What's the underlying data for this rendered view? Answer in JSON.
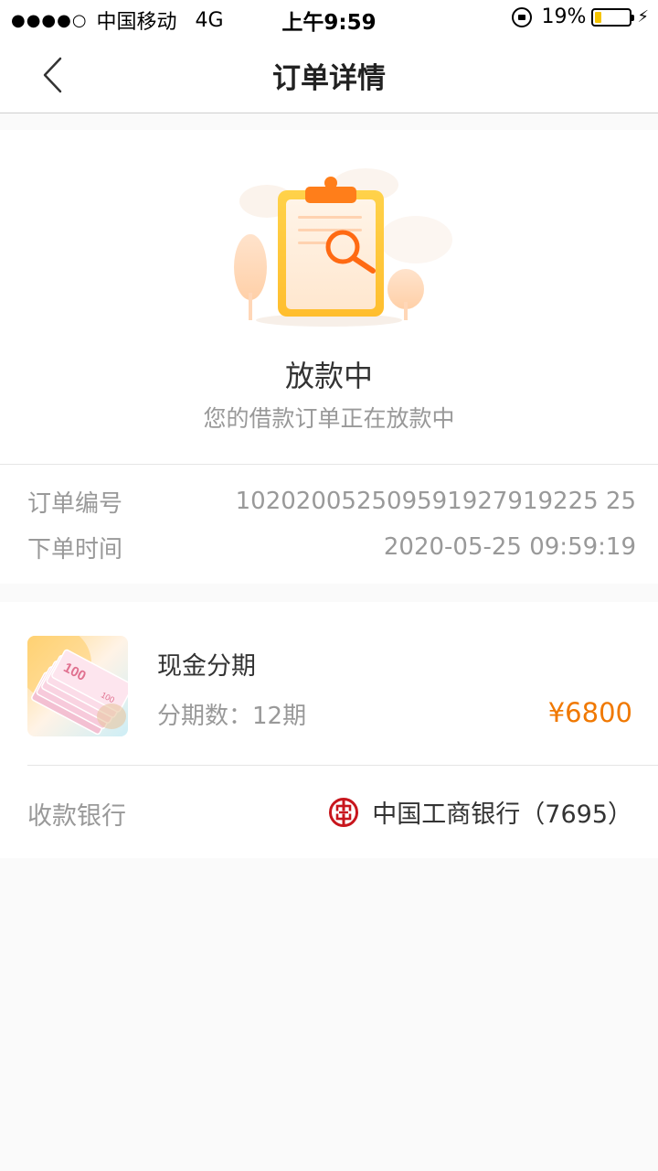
{
  "status_bar": {
    "signal": "●●●●○",
    "carrier": "中国移动",
    "network": "4G",
    "time": "上午9:59",
    "battery": "19%",
    "battery_level": 0.19,
    "icons": [
      "signal-dots-icon",
      "orientation-lock-icon",
      "battery-icon",
      "charging-bolt-icon"
    ]
  },
  "nav": {
    "title": "订单详情",
    "back_icon": "chevron-left-icon"
  },
  "status": {
    "title": "放款中",
    "subtitle": "您的借款订单正在放款中",
    "illustration_icon": "clipboard-search-icon"
  },
  "order_info": {
    "order_no_label": "订单编号",
    "order_no": "102020052509591927919225 25",
    "order_time_label": "下单时间",
    "order_time": "2020-05-25 09:59:19"
  },
  "product": {
    "name": "现金分期",
    "periods_label": "分期数：",
    "periods_value": "12期",
    "price": "¥6800",
    "thumb_icon": "cash-banknotes-icon",
    "thumb_text": "100"
  },
  "bank": {
    "label": "收款银行",
    "name": "中国工商银行（7695）",
    "logo_icon": "icbc-logo-icon"
  },
  "colors": {
    "accent": "#f07800",
    "muted_text": "#999999",
    "battery": "#f5c400",
    "bank_logo": "#c8161d"
  }
}
